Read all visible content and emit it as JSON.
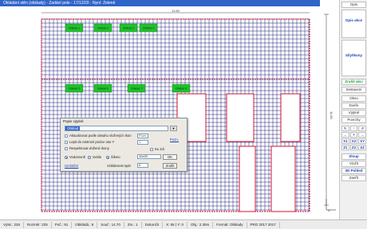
{
  "window": {
    "title": "Okládání stěn (obklady) - Zadání pole - 17/12/20 - Nyní: Zeleně"
  },
  "drawing": {
    "dim_top": "11.60",
    "dim_right": "11.60",
    "grid_color": "#1b1b7a",
    "border_color": "#d0021b",
    "tile_label_color": "#21c12d",
    "tile_labels": [
      "Obklad 1",
      "Obklad 2",
      "Obklad 3",
      "Obklad 4",
      "Obklad 5",
      "Obklad 6",
      "Obklad 7",
      "Obklad 8"
    ]
  },
  "right_panel": {
    "top_btn": "Opis",
    "btn_line1": "Opis akce",
    "btn_line2": "Síly/Ikony",
    "zoom_btn": "Zrušit akci",
    "measure_btn": "Sestavení",
    "grid_rows": [
      [
        "↖",
        "↑",
        "↗"
      ],
      [
        "←",
        "+",
        "→"
      ],
      [
        "X1",
        "X2",
        "XY"
      ],
      [
        "Z1",
        "Z2",
        "ZZ"
      ]
    ],
    "list_items": [
      "Okno",
      "Dveře",
      "Výplně",
      "Povrchy",
      "Vrstva"
    ],
    "bottom_btns": [
      "Sloup",
      "Vložit",
      "3D Pohled",
      "Zavřít"
    ]
  },
  "dialog": {
    "title": "Popis výplně",
    "name_value": "Obklad",
    "opt1": "Aktualizovat podle obsahu vložených ikon",
    "opt1_hint": "Pozn.",
    "opt2": "Lepit do rastrové pozice osu Y",
    "opt2_value": "1",
    "opt3": "Respektovat vložené ikony",
    "opt4": "Ke zdi",
    "link1": "Umístit",
    "radio1": "Vodorovně",
    "radio2": "Svisle",
    "radio3": "Šikmo",
    "size_value": "10x20",
    "spacing_label": "Vzdálenost spár",
    "spacing_value": "0",
    "link_bottom": "Umístění",
    "ok_label": "OK",
    "cancel_label": "Zrušit"
  },
  "status_bar": {
    "cells": [
      "Výsk.: 226",
      "Rozměr: 225",
      "Poč.: 91",
      "Obkládá.: 8",
      "Souř.: 14.70",
      "Zm.: 1",
      "Dokončit",
      "X: 65 | Y: 0",
      "Obj.: 2.30m",
      "Formát: Obklady",
      "PRO 2017 2017"
    ]
  }
}
